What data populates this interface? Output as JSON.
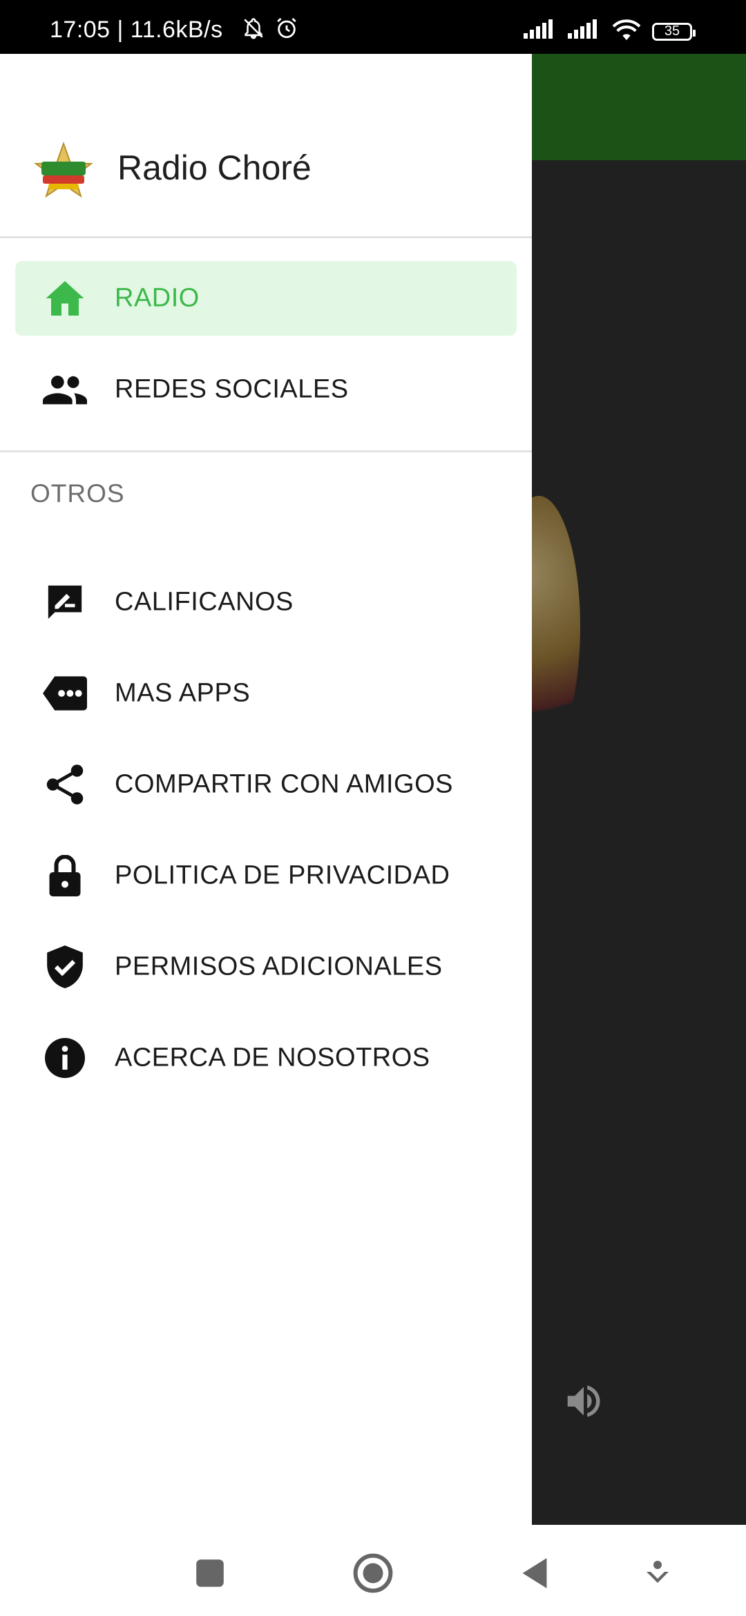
{
  "status_bar": {
    "time": "17:05 | 11.6kB/s",
    "battery": "35",
    "icons": [
      "bell-off-icon",
      "alarm-icon",
      "signal-icon",
      "signal-icon",
      "wifi-icon",
      "battery-icon"
    ]
  },
  "drawer": {
    "title": "Radio Choré",
    "logo_icon": "radio-logo-icon",
    "items": [
      {
        "label": "RADIO",
        "icon": "home-icon",
        "active": true
      },
      {
        "label": "REDES SOCIALES",
        "icon": "people-icon",
        "active": false
      }
    ],
    "section_title": "OTROS",
    "other_items": [
      {
        "label": "CALIFICANOS",
        "icon": "rate-review-icon"
      },
      {
        "label": "MAS APPS",
        "icon": "more-apps-icon"
      },
      {
        "label": "COMPARTIR CON AMIGOS",
        "icon": "share-icon"
      },
      {
        "label": "POLITICA DE PRIVACIDAD",
        "icon": "lock-icon"
      },
      {
        "label": "PERMISOS ADICIONALES",
        "icon": "shield-check-icon"
      },
      {
        "label": "ACERCA DE NOSOTROS",
        "icon": "info-icon"
      }
    ]
  },
  "background_app": {
    "toolbar_color": "#1b5317",
    "volume_icon": "volume-icon"
  },
  "colors": {
    "accent": "#3cb94a",
    "active_bg": "#e3f8e4"
  },
  "navbar": {
    "buttons": [
      "recents-icon",
      "home-circle-icon",
      "back-icon",
      "assist-icon"
    ]
  }
}
